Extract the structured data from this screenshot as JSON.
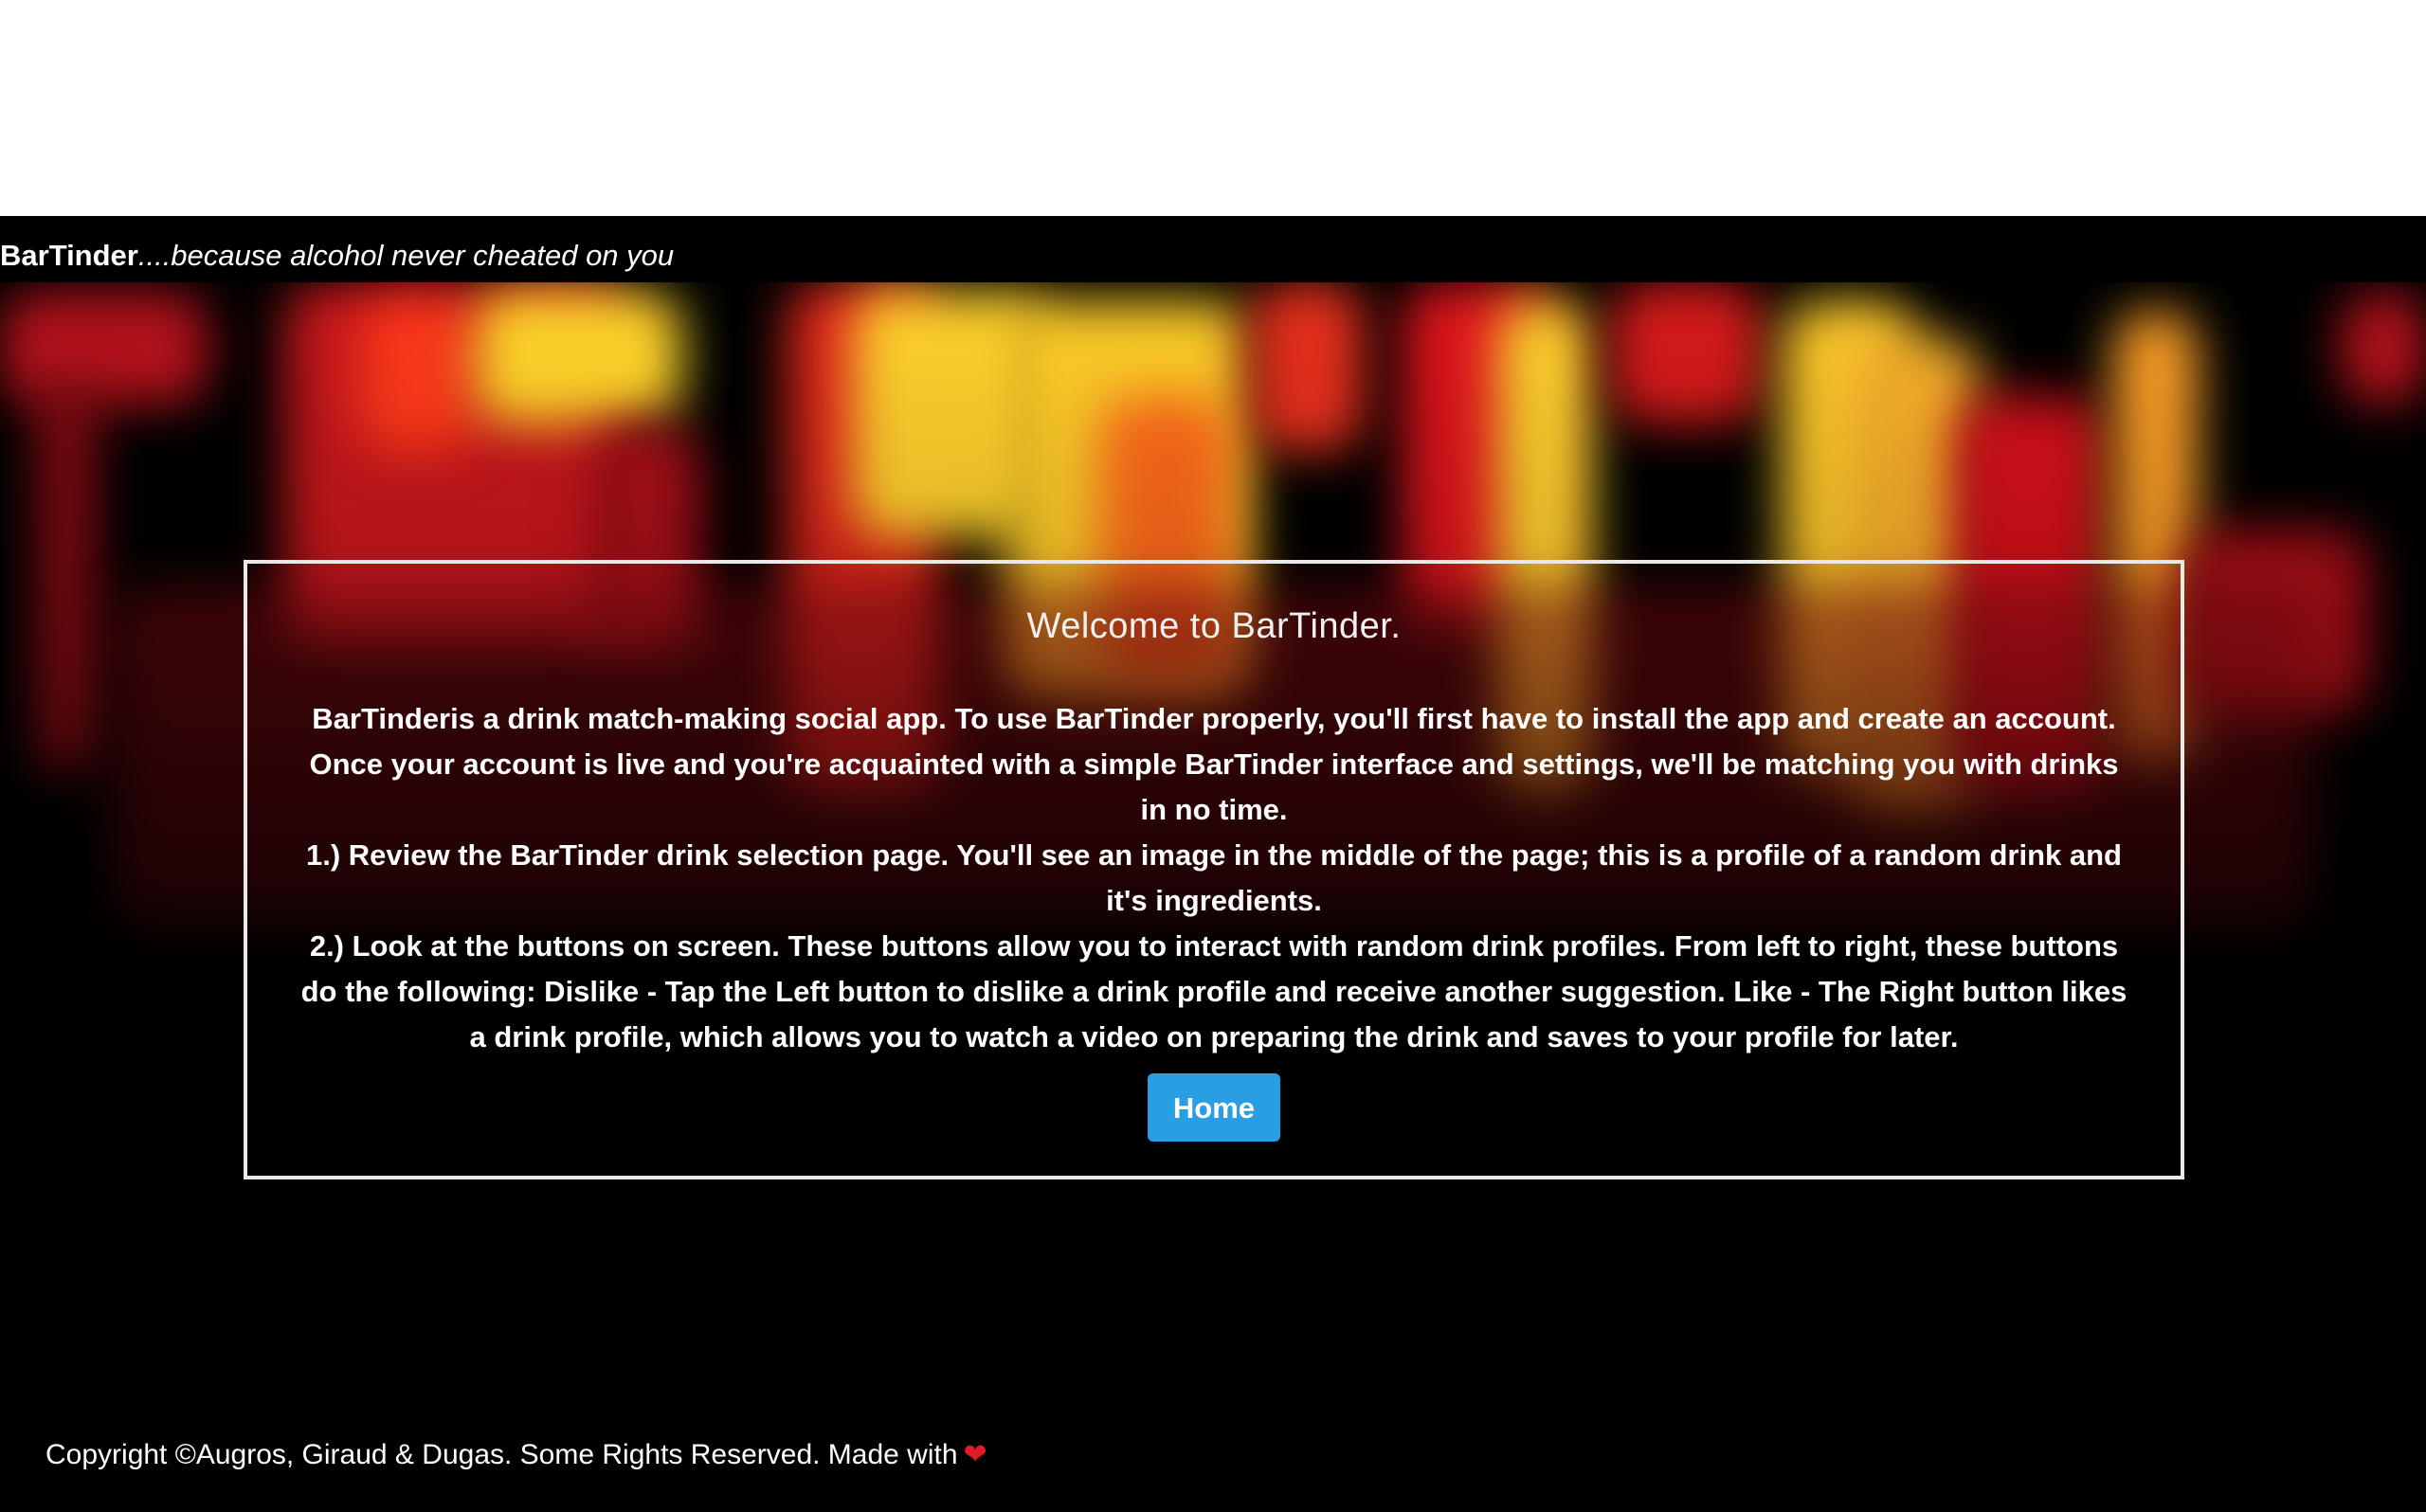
{
  "header": {
    "brand_name": "BarTinder",
    "tagline": "....because alcohol never cheated on you"
  },
  "welcome": {
    "title": "Welcome to BarTinder.",
    "intro": "BarTinderis a drink match-making social app. To use BarTinder properly, you'll first have to install the app and create an account. Once your account is live and you're acquainted with a simple BarTinder interface and settings, we'll be matching you with drinks in no time.",
    "step1": "1.) Review the BarTinder drink selection page. You'll see an image in the middle of the page; this is a profile of a random drink and it's ingredients.",
    "step2": "2.) Look at the buttons on screen. These buttons allow you to interact with random drink profiles. From left to right, these buttons do the following: Dislike - Tap the Left button to dislike a drink profile and receive another suggestion. Like - The Right button likes a drink profile, which allows you to watch a video on preparing the drink and saves to your profile for later.",
    "home_button": "Home"
  },
  "footer": {
    "copyright": "Copyright ©Augros, Giraud & Dugas. Some Rights Reserved. Made with",
    "heart_icon": "heart-icon"
  },
  "colors": {
    "button_bg": "#2a9ee3",
    "heart": "#e21b2a",
    "background": "#000000",
    "text": "#ffffff"
  }
}
